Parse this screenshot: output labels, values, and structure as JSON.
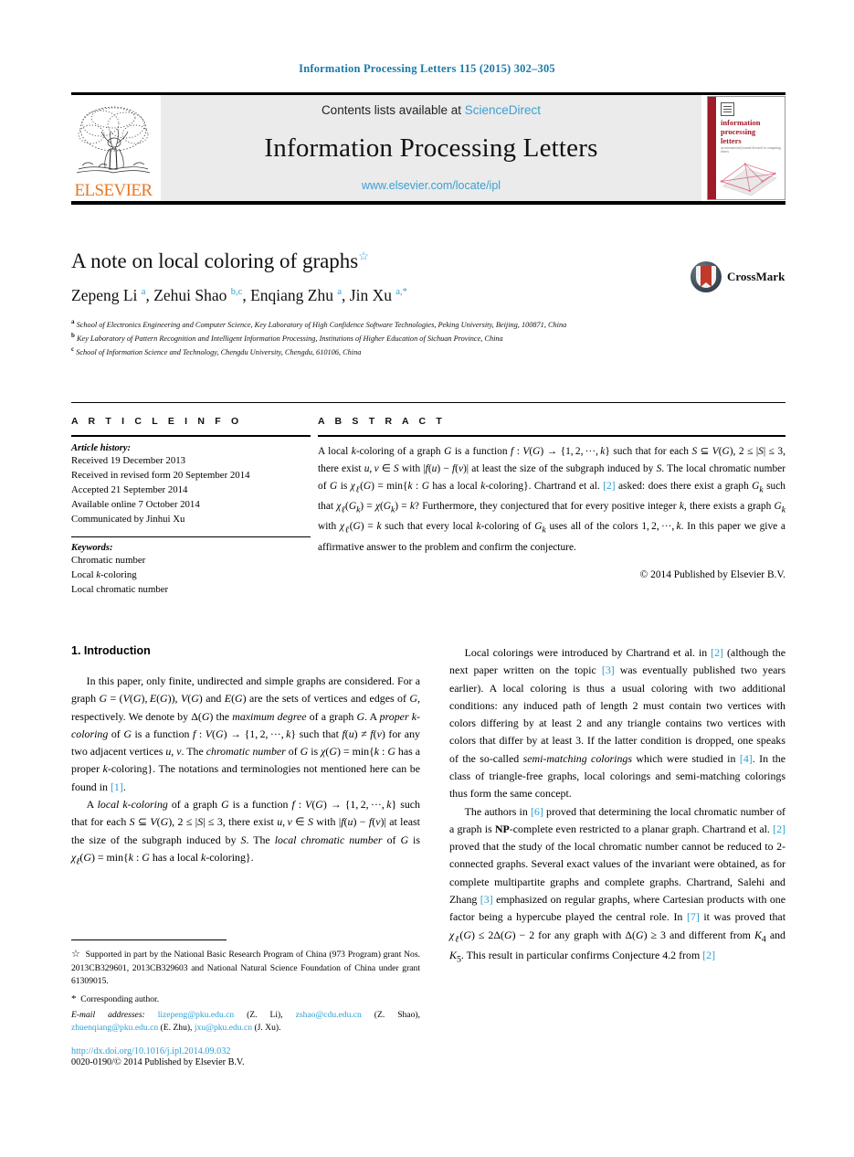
{
  "running_head": "Information Processing Letters 115 (2015) 302–305",
  "masthead": {
    "contents_prefix": "Contents lists available at ",
    "sciencedirect": "ScienceDirect",
    "journal_title": "Information Processing Letters",
    "journal_url": "www.elsevier.com/locate/ipl",
    "publisher_wordmark": "ELSEVIER",
    "cover": {
      "line1": "information",
      "line2": "processing",
      "line3": "letters",
      "subtitle": "an international journal devoted to computing theory"
    }
  },
  "article": {
    "title": "A note on local coloring of graphs",
    "title_footnote_marker": "☆",
    "authors_html": "Zepeng Li <sup>a</sup>, Zehui Shao <sup>b,c</sup>, Enqiang Zhu <sup>a</sup>, Jin Xu <sup>a,</sup><sup>*</sup>",
    "affiliations": [
      {
        "label": "a",
        "text": "School of Electronics Engineering and Computer Science, Key Laboratory of High Confidence Software Technologies, Peking University, Beijing, 100871, China"
      },
      {
        "label": "b",
        "text": "Key Laboratory of Pattern Recognition and Intelligent Information Processing, Institutions of Higher Education of Sichuan Province, China"
      },
      {
        "label": "c",
        "text": "School of Information Science and Technology, Chengdu University, Chengdu, 610106, China"
      }
    ],
    "crossmark_label": "CrossMark"
  },
  "article_info": {
    "heading": "A R T I C L E    I N F O",
    "history_label": "Article history:",
    "history": [
      "Received 19 December 2013",
      "Received in revised form 20 September 2014",
      "Accepted 21 September 2014",
      "Available online 7 October 2014",
      "Communicated by Jinhui Xu"
    ],
    "keywords_label": "Keywords:",
    "keywords_html": [
      "Chromatic number",
      "Local <i>k</i>-coloring",
      "Local chromatic number"
    ]
  },
  "abstract": {
    "heading": "A B S T R A C T",
    "text_html": "A local <i>k</i>-coloring of a graph <i>G</i> is a function <i>f</i> : <i>V</i>(<i>G</i>) &rarr; {1,&thinsp;2,&thinsp;&middot;&middot;&middot;,&thinsp;<i>k</i>} such that for each <i>S</i> &sube; <i>V</i>(<i>G</i>), 2 &le; |<i>S</i>| &le; 3, there exist <i>u</i>,&thinsp;<i>v</i> &isin; <i>S</i> with |<i>f</i>(<i>u</i>) &minus; <i>f</i>(<i>v</i>)| at least the size of the subgraph induced by <i>S</i>. The local chromatic number of <i>G</i> is <i>&chi;<sub>&#8467;</sub></i>(<i>G</i>) = min{<i>k</i> : <i>G</i> has a local <i>k</i>-coloring}. Chartrand et al. <span class=\"ref\">[2]</span> asked: does there exist a graph <i>G<sub>k</sub></i> such that <i>&chi;<sub>&#8467;</sub></i>(<i>G<sub>k</sub></i>) = <i>&chi;</i>(<i>G<sub>k</sub></i>) = <i>k</i>? Furthermore, they conjectured that for every positive integer <i>k</i>, there exists a graph <i>G<sub>k</sub></i> with <i>&chi;<sub>&#8467;</sub></i>(<i>G</i>) = <i>k</i> such that every local <i>k</i>-coloring of <i>G<sub>k</sub></i> uses all of the colors 1,&thinsp;2,&thinsp;&middot;&middot;&middot;,&thinsp;<i>k</i>. In this paper we give a affirmative answer to the problem and confirm the conjecture.",
    "copyright": "© 2014 Published by Elsevier B.V."
  },
  "body": {
    "section1_heading": "1. Introduction",
    "left_paragraphs_html": [
      "In this paper, only finite, undirected and simple graphs are considered. For a graph <i>G</i> = (<i>V</i>(<i>G</i>),&thinsp;<i>E</i>(<i>G</i>)), <i>V</i>(<i>G</i>) and <i>E</i>(<i>G</i>) are the sets of vertices and edges of <i>G</i>, respectively. We denote by &Delta;(<i>G</i>) the <i>maximum degree</i> of a graph <i>G</i>. A <i>proper k-coloring</i> of <i>G</i> is a function <i>f</i> : <i>V</i>(<i>G</i>) &rarr; {1,&thinsp;2,&thinsp;&middot;&middot;&middot;,&thinsp;<i>k</i>} such that <i>f</i>(<i>u</i>) &ne; <i>f</i>(<i>v</i>) for any two adjacent vertices <i>u</i>, <i>v</i>. The <i>chromatic number</i> of <i>G</i> is <i>&chi;</i>(<i>G</i>) = min{<i>k</i> : <i>G</i> has a proper <i>k</i>-coloring}. The notations and terminologies not mentioned here can be found in <span class=\"ref\">[1]</span>.",
      "A <i>local k-coloring</i> of a graph <i>G</i> is a function <i>f</i> : <i>V</i>(<i>G</i>) &rarr; {1,&thinsp;2,&thinsp;&middot;&middot;&middot;,&thinsp;<i>k</i>} such that for each <i>S</i> &sube; <i>V</i>(<i>G</i>), 2 &le; |<i>S</i>| &le; 3, there exist <i>u</i>,&thinsp;<i>v</i> &isin; <i>S</i> with |<i>f</i>(<i>u</i>) &minus; <i>f</i>(<i>v</i>)| at least the size of the subgraph induced by <i>S</i>. The <i>local chromatic number</i> of <i>G</i> is <i>&chi;<sub>&#8467;</sub></i>(<i>G</i>) = min{<i>k</i> : <i>G</i> has a local <i>k</i>-coloring}."
    ],
    "right_paragraphs_html": [
      "Local colorings were introduced by Chartrand et al. in <span class=\"ref\">[2]</span> (although the next paper written on the topic <span class=\"ref\">[3]</span> was eventually published two years earlier). A local coloring is thus a usual coloring with two additional conditions: any induced path of length 2 must contain two vertices with colors differing by at least 2 and any triangle contains two vertices with colors that differ by at least 3. If the latter condition is dropped, one speaks of the so-called <i>semi-matching colorings</i> which were studied in <span class=\"ref\">[4]</span>. In the class of triangle-free graphs, local colorings and semi-matching colorings thus form the same concept.",
      "The authors in <span class=\"ref\">[6]</span> proved that determining the local chromatic number of a graph is <b>NP</b>-complete even restricted to a planar graph. Chartrand et al. <span class=\"ref\">[2]</span> proved that the study of the local chromatic number cannot be reduced to 2-connected graphs. Several exact values of the invariant were obtained, as for complete multipartite graphs and complete graphs. Chartrand, Salehi and Zhang <span class=\"ref\">[3]</span> emphasized on regular graphs, where Cartesian products with one factor being a hypercube played the central role. In <span class=\"ref\">[7]</span> it was proved that <i>&chi;<sub>&#8467;</sub></i>(<i>G</i>) &le; 2&Delta;(<i>G</i>) &minus; 2 for any graph with &Delta;(<i>G</i>) &ge; 3 and different from <i>K</i><sub>4</sub> and <i>K</i><sub>5</sub>. This result in particular confirms Conjecture 4.2 from <span class=\"ref\">[2]</span>"
    ]
  },
  "footnotes": {
    "funding_html": "<span class=\"marker\">&#9734;</span>&nbsp; Supported in part by the National Basic Research Program of China (973 Program) grant Nos. 2013CB329601, 2013CB329603 and National Natural Science Foundation of China under grant 61309015.",
    "corresponding_html": "<span class=\"marker\">*</span>&nbsp; Corresponding author.",
    "emails_html": "<i>E-mail addresses:</i> <span class=\"mail\">lizepeng@pku.edu.cn</span> (Z. Li), <span class=\"mail\">zshao@cdu.edu.cn</span> (Z. Shao), <span class=\"mail\">zhuenqiang@pku.edu.cn</span> (E. Zhu), <span class=\"mail\">jxu@pku.edu.cn</span> (J. Xu).",
    "doi": "http://dx.doi.org/10.1016/j.ipl.2014.09.032",
    "issn_line": "0020-0190/© 2014 Published by Elsevier B.V."
  },
  "colors": {
    "link_blue": "#2e9fd4",
    "runhead_blue": "#1a7aa8",
    "elsevier_orange": "#E87722",
    "cover_red": "#9e1b27",
    "masthead_grey": "#ebebeb"
  }
}
